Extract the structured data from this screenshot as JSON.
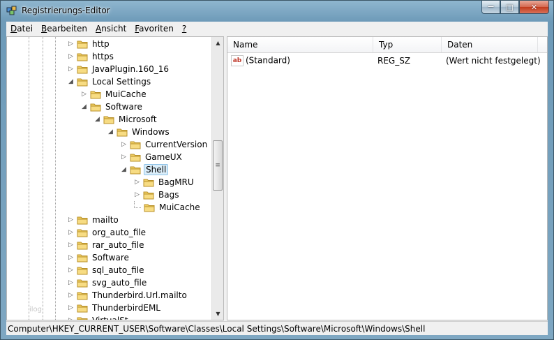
{
  "window": {
    "title": "Registrierungs-Editor"
  },
  "menu": [
    {
      "label": "Datei",
      "key": "D",
      "rest": "atei"
    },
    {
      "label": "Bearbeiten",
      "key": "B",
      "rest": "earbeiten"
    },
    {
      "label": "Ansicht",
      "key": "A",
      "rest": "nsicht"
    },
    {
      "label": "Favoriten",
      "key": "F",
      "rest": "avoriten"
    },
    {
      "label": "?",
      "key": "?",
      "rest": ""
    }
  ],
  "tree": {
    "items": [
      {
        "label": "http",
        "expander": "▷"
      },
      {
        "label": "https",
        "expander": "▷"
      },
      {
        "label": "JavaPlugin.160_16",
        "expander": "▷"
      },
      {
        "label": "Local Settings",
        "expander": "◢"
      },
      {
        "label": "MuiCache",
        "expander": "▷"
      },
      {
        "label": "Software",
        "expander": "◢"
      },
      {
        "label": "Microsoft",
        "expander": "◢"
      },
      {
        "label": "Windows",
        "expander": "◢"
      },
      {
        "label": "CurrentVersion",
        "expander": "▷"
      },
      {
        "label": "GameUX",
        "expander": "▷"
      },
      {
        "label": "Shell",
        "expander": "◢",
        "selected": true
      },
      {
        "label": "BagMRU",
        "expander": "▷"
      },
      {
        "label": "Bags",
        "expander": "▷"
      },
      {
        "label": "MuiCache",
        "expander": ""
      },
      {
        "label": "mailto",
        "expander": "▷"
      },
      {
        "label": "org_auto_file",
        "expander": "▷"
      },
      {
        "label": "rar_auto_file",
        "expander": "▷"
      },
      {
        "label": "Software",
        "expander": "▷"
      },
      {
        "label": "sql_auto_file",
        "expander": "▷"
      },
      {
        "label": "svg_auto_file",
        "expander": "▷"
      },
      {
        "label": "Thunderbird.Url.mailto",
        "expander": "▷"
      },
      {
        "label": "ThunderbirdEML",
        "expander": "▷"
      },
      {
        "label": "VirtualSt...",
        "expander": "▷"
      }
    ],
    "ghost_text": "ilog"
  },
  "list": {
    "columns": [
      "Name",
      "Typ",
      "Daten"
    ],
    "rows": [
      {
        "name": "(Standard)",
        "type": "REG_SZ",
        "data": "(Wert nicht festgelegt)",
        "icon": "string-value-icon",
        "icon_text": "ab"
      }
    ]
  },
  "status": {
    "path": "Computer\\HKEY_CURRENT_USER\\Software\\Classes\\Local Settings\\Software\\Microsoft\\Windows\\Shell"
  },
  "scroll": {
    "up": "▲",
    "down": "▼",
    "grip": "≡"
  },
  "captions": {
    "minimize": "—",
    "maximize": "□",
    "close": "✕"
  }
}
